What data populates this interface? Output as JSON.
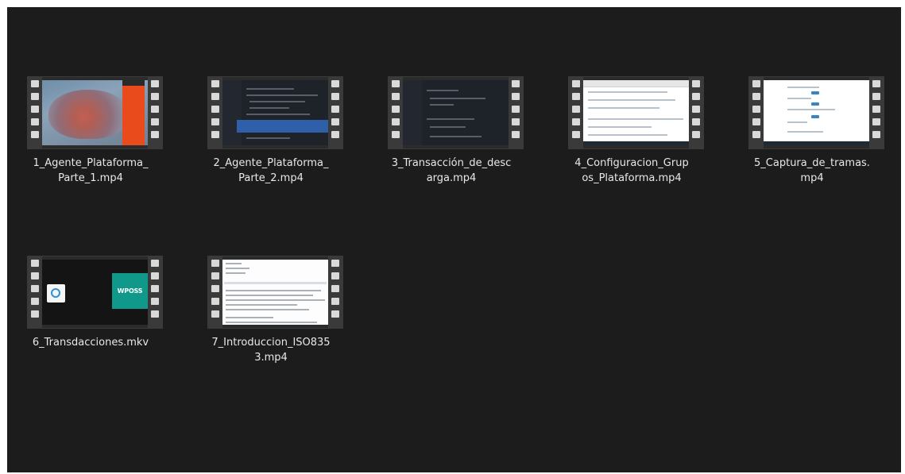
{
  "files": [
    {
      "name_lines": [
        "1_Agente_Plataforma_",
        "Parte_1.mp4"
      ],
      "thumbnail": "red-car-video-frame"
    },
    {
      "name_lines": [
        "2_Agente_Plataforma_",
        "Parte_2.mp4"
      ],
      "thumbnail": "code-editor-frame"
    },
    {
      "name_lines": [
        "3_Transacción_de_desc",
        "arga.mp4"
      ],
      "thumbnail": "code-editor-frame"
    },
    {
      "name_lines": [
        "4_Configuracion_Grup",
        "os_Plataforma.mp4"
      ],
      "thumbnail": "web-page-frame"
    },
    {
      "name_lines": [
        "5_Captura_de_tramas.",
        "mp4"
      ],
      "thumbnail": "web-page-frame"
    },
    {
      "name_lines": [
        "6_Transdacciones.mkv"
      ],
      "thumbnail": "wposs-logo-frame"
    },
    {
      "name_lines": [
        "7_Introduccion_ISO835",
        "3.mp4"
      ],
      "thumbnail": "document-frame"
    }
  ],
  "logo_text": "WPOSS",
  "colors": {
    "background": "#1c1c1c",
    "text": "#e8e8e8",
    "film_strip": "#3a3a3a",
    "wposs_teal": "#10998a",
    "highlight_blue": "#2f5fa9"
  }
}
